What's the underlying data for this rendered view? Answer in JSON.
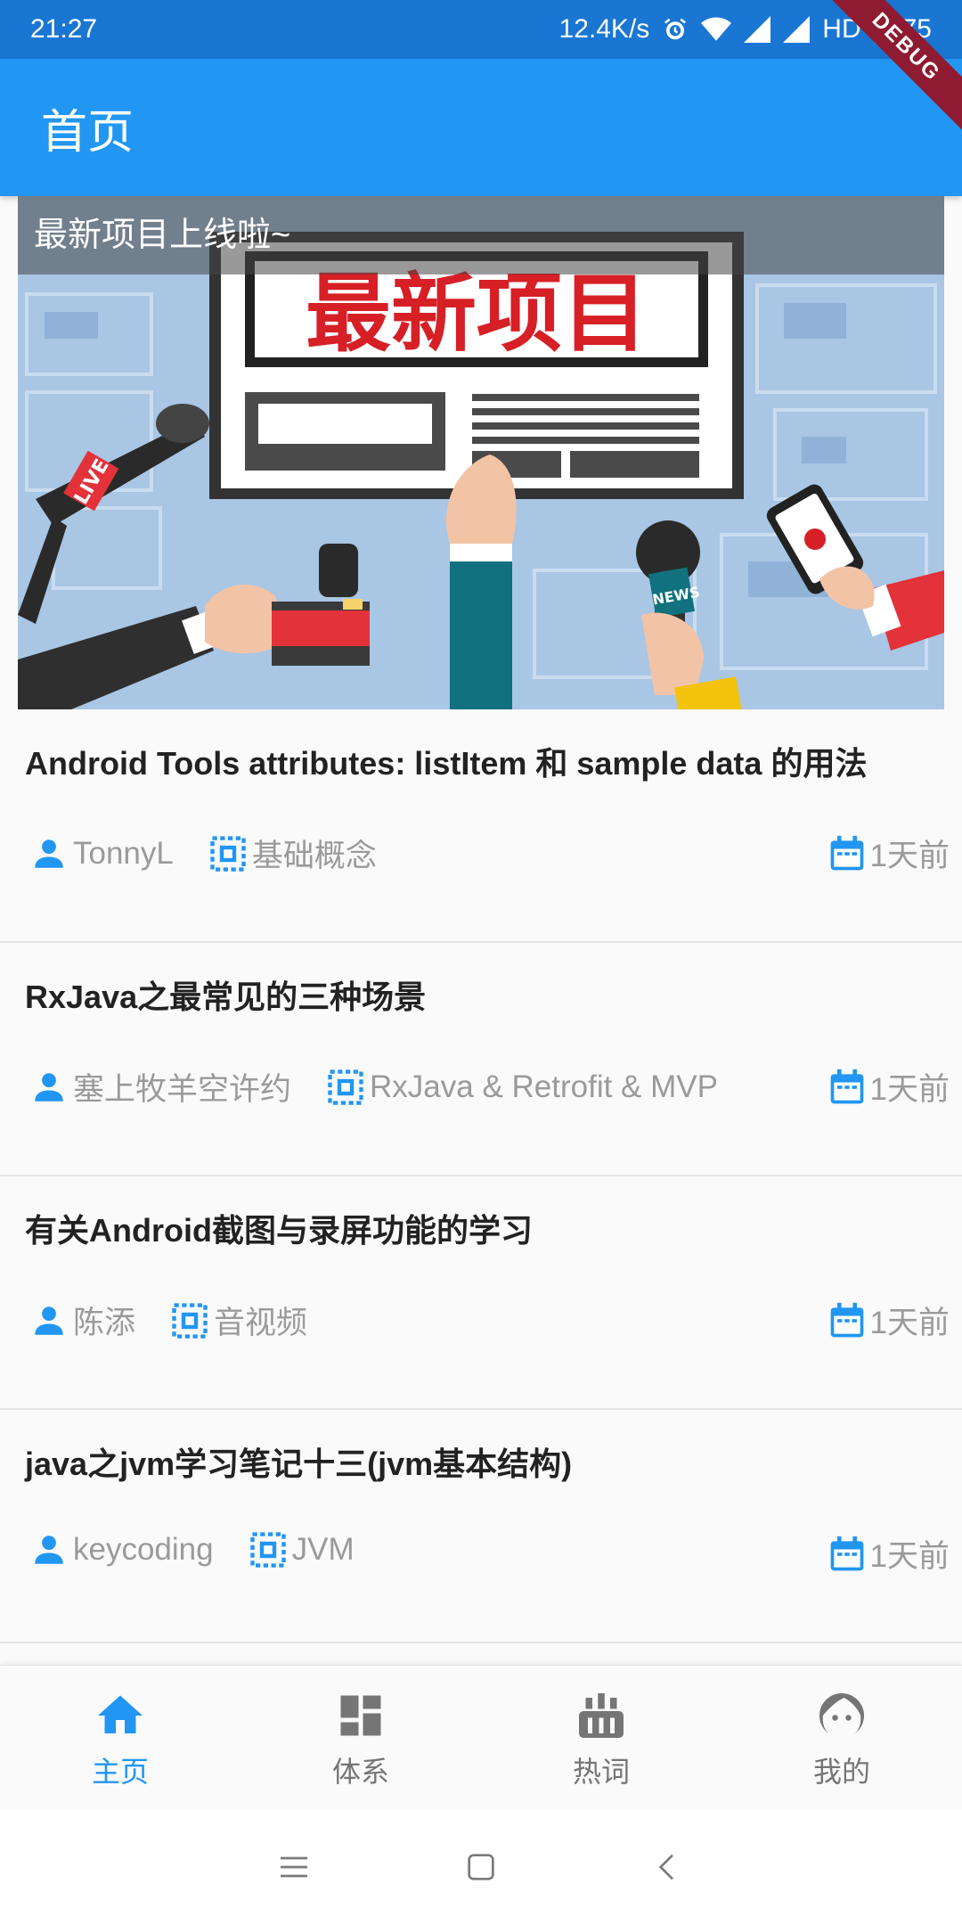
{
  "status_bar": {
    "time": "21:27",
    "net_speed": "12.4K/s",
    "hd": "HD",
    "battery": "75",
    "icons": [
      "alarm-icon",
      "wifi-icon",
      "signal-icon",
      "signal-icon",
      "battery-icon"
    ]
  },
  "debug_banner": "DEBUG",
  "app_bar": {
    "title": "首页"
  },
  "banner": {
    "caption": "最新项目上线啦~",
    "headline": "最新项目",
    "live_tag": "LIVE",
    "news_tag": "NEWS"
  },
  "articles": [
    {
      "title": "Android Tools attributes: listItem 和 sample data 的用法",
      "author": "TonnyL",
      "category": "基础概念",
      "date": "1天前"
    },
    {
      "title": "RxJava之最常见的三种场景",
      "author": "塞上牧羊空许约",
      "category": "RxJava & Retrofit & MVP",
      "date": "1天前"
    },
    {
      "title": "有关Android截图与录屏功能的学习",
      "author": "陈添",
      "category": "音视频",
      "date": "1天前"
    },
    {
      "title": "java之jvm学习笔记十三(jvm基本结构)",
      "author": "keycoding",
      "category": "JVM",
      "date": "1天前"
    }
  ],
  "bottom_nav": [
    {
      "label": "主页",
      "icon": "home-icon",
      "active": true
    },
    {
      "label": "体系",
      "icon": "dashboard-icon",
      "active": false
    },
    {
      "label": "热词",
      "icon": "hot-icon",
      "active": false
    },
    {
      "label": "我的",
      "icon": "face-icon",
      "active": false
    }
  ],
  "colors": {
    "primary": "#2196f3",
    "status_bar": "#1976d2",
    "debug": "#8e1b31",
    "meta_text": "#9a9a9a"
  }
}
